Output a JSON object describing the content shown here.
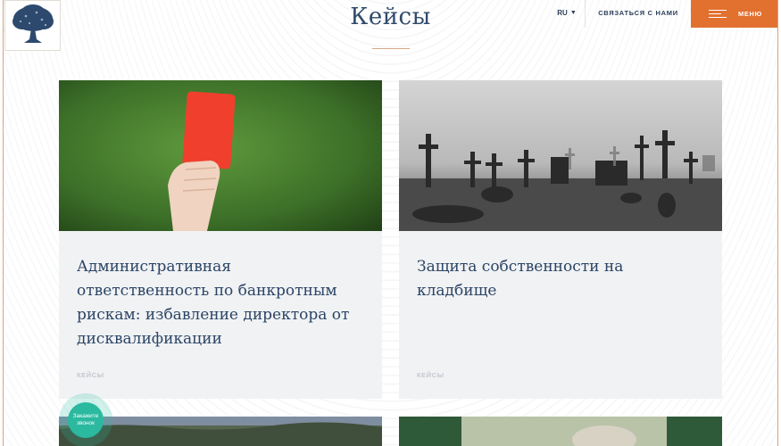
{
  "header": {
    "page_title": "Кейсы",
    "lang": "RU",
    "contact_label": "СВЯЗАТЬСЯ С НАМИ",
    "menu_label": "МЕНЮ"
  },
  "cards": [
    {
      "title": "Административная ответственность по банкротным рискам: избавление директора от дисквалификации",
      "tag": "КЕЙСЫ"
    },
    {
      "title": "Защита собственности на кладбище",
      "tag": "КЕЙСЫ"
    }
  ],
  "callback": {
    "label": "Закажите звонок"
  },
  "colors": {
    "accent": "#e2702f",
    "title": "#2b4565",
    "card_bg": "#f1f2f4",
    "callback": "#2bb9a0"
  }
}
